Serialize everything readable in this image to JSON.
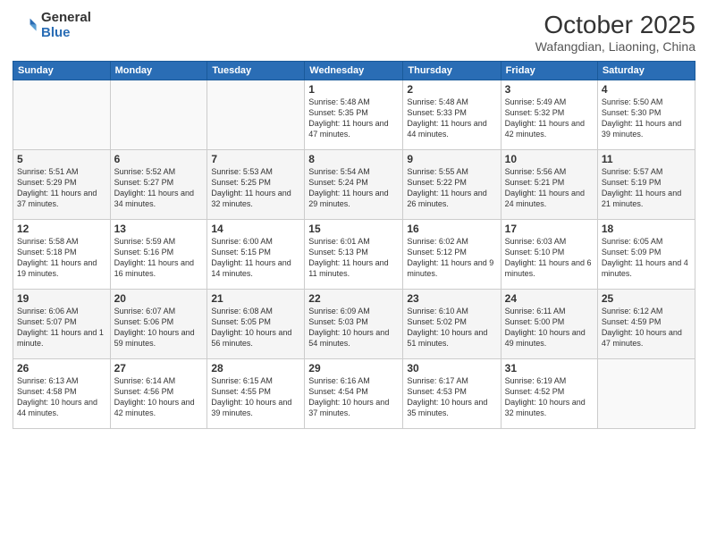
{
  "logo": {
    "general": "General",
    "blue": "Blue"
  },
  "title": "October 2025",
  "location": "Wafangdian, Liaoning, China",
  "weekdays": [
    "Sunday",
    "Monday",
    "Tuesday",
    "Wednesday",
    "Thursday",
    "Friday",
    "Saturday"
  ],
  "weeks": [
    [
      {
        "day": "",
        "info": ""
      },
      {
        "day": "",
        "info": ""
      },
      {
        "day": "",
        "info": ""
      },
      {
        "day": "1",
        "info": "Sunrise: 5:48 AM\nSunset: 5:35 PM\nDaylight: 11 hours and 47 minutes."
      },
      {
        "day": "2",
        "info": "Sunrise: 5:48 AM\nSunset: 5:33 PM\nDaylight: 11 hours and 44 minutes."
      },
      {
        "day": "3",
        "info": "Sunrise: 5:49 AM\nSunset: 5:32 PM\nDaylight: 11 hours and 42 minutes."
      },
      {
        "day": "4",
        "info": "Sunrise: 5:50 AM\nSunset: 5:30 PM\nDaylight: 11 hours and 39 minutes."
      }
    ],
    [
      {
        "day": "5",
        "info": "Sunrise: 5:51 AM\nSunset: 5:29 PM\nDaylight: 11 hours and 37 minutes."
      },
      {
        "day": "6",
        "info": "Sunrise: 5:52 AM\nSunset: 5:27 PM\nDaylight: 11 hours and 34 minutes."
      },
      {
        "day": "7",
        "info": "Sunrise: 5:53 AM\nSunset: 5:25 PM\nDaylight: 11 hours and 32 minutes."
      },
      {
        "day": "8",
        "info": "Sunrise: 5:54 AM\nSunset: 5:24 PM\nDaylight: 11 hours and 29 minutes."
      },
      {
        "day": "9",
        "info": "Sunrise: 5:55 AM\nSunset: 5:22 PM\nDaylight: 11 hours and 26 minutes."
      },
      {
        "day": "10",
        "info": "Sunrise: 5:56 AM\nSunset: 5:21 PM\nDaylight: 11 hours and 24 minutes."
      },
      {
        "day": "11",
        "info": "Sunrise: 5:57 AM\nSunset: 5:19 PM\nDaylight: 11 hours and 21 minutes."
      }
    ],
    [
      {
        "day": "12",
        "info": "Sunrise: 5:58 AM\nSunset: 5:18 PM\nDaylight: 11 hours and 19 minutes."
      },
      {
        "day": "13",
        "info": "Sunrise: 5:59 AM\nSunset: 5:16 PM\nDaylight: 11 hours and 16 minutes."
      },
      {
        "day": "14",
        "info": "Sunrise: 6:00 AM\nSunset: 5:15 PM\nDaylight: 11 hours and 14 minutes."
      },
      {
        "day": "15",
        "info": "Sunrise: 6:01 AM\nSunset: 5:13 PM\nDaylight: 11 hours and 11 minutes."
      },
      {
        "day": "16",
        "info": "Sunrise: 6:02 AM\nSunset: 5:12 PM\nDaylight: 11 hours and 9 minutes."
      },
      {
        "day": "17",
        "info": "Sunrise: 6:03 AM\nSunset: 5:10 PM\nDaylight: 11 hours and 6 minutes."
      },
      {
        "day": "18",
        "info": "Sunrise: 6:05 AM\nSunset: 5:09 PM\nDaylight: 11 hours and 4 minutes."
      }
    ],
    [
      {
        "day": "19",
        "info": "Sunrise: 6:06 AM\nSunset: 5:07 PM\nDaylight: 11 hours and 1 minute."
      },
      {
        "day": "20",
        "info": "Sunrise: 6:07 AM\nSunset: 5:06 PM\nDaylight: 10 hours and 59 minutes."
      },
      {
        "day": "21",
        "info": "Sunrise: 6:08 AM\nSunset: 5:05 PM\nDaylight: 10 hours and 56 minutes."
      },
      {
        "day": "22",
        "info": "Sunrise: 6:09 AM\nSunset: 5:03 PM\nDaylight: 10 hours and 54 minutes."
      },
      {
        "day": "23",
        "info": "Sunrise: 6:10 AM\nSunset: 5:02 PM\nDaylight: 10 hours and 51 minutes."
      },
      {
        "day": "24",
        "info": "Sunrise: 6:11 AM\nSunset: 5:00 PM\nDaylight: 10 hours and 49 minutes."
      },
      {
        "day": "25",
        "info": "Sunrise: 6:12 AM\nSunset: 4:59 PM\nDaylight: 10 hours and 47 minutes."
      }
    ],
    [
      {
        "day": "26",
        "info": "Sunrise: 6:13 AM\nSunset: 4:58 PM\nDaylight: 10 hours and 44 minutes."
      },
      {
        "day": "27",
        "info": "Sunrise: 6:14 AM\nSunset: 4:56 PM\nDaylight: 10 hours and 42 minutes."
      },
      {
        "day": "28",
        "info": "Sunrise: 6:15 AM\nSunset: 4:55 PM\nDaylight: 10 hours and 39 minutes."
      },
      {
        "day": "29",
        "info": "Sunrise: 6:16 AM\nSunset: 4:54 PM\nDaylight: 10 hours and 37 minutes."
      },
      {
        "day": "30",
        "info": "Sunrise: 6:17 AM\nSunset: 4:53 PM\nDaylight: 10 hours and 35 minutes."
      },
      {
        "day": "31",
        "info": "Sunrise: 6:19 AM\nSunset: 4:52 PM\nDaylight: 10 hours and 32 minutes."
      },
      {
        "day": "",
        "info": ""
      }
    ]
  ]
}
